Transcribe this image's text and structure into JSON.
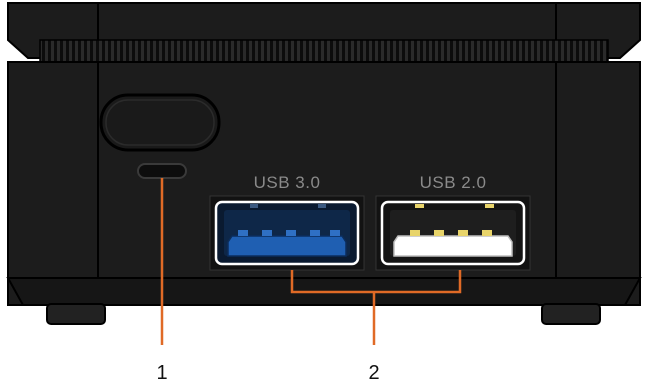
{
  "ports": [
    {
      "label": "USB 3.0",
      "insert_color": "#1f5fb2"
    },
    {
      "label": "USB 2.0",
      "insert_color": "#ffffff"
    }
  ],
  "callouts": [
    {
      "number": "1",
      "target": "power-indicator"
    },
    {
      "number": "2",
      "target": "usb-ports"
    }
  ],
  "colors": {
    "chassis": "#1c1c1c",
    "chassis_dark": "#111111",
    "outline": "#000000",
    "callout_line": "#e06a26",
    "usb3_blue": "#1f5fb2",
    "usb2_white": "#ffffff",
    "label_gray": "#8a8a8a"
  }
}
